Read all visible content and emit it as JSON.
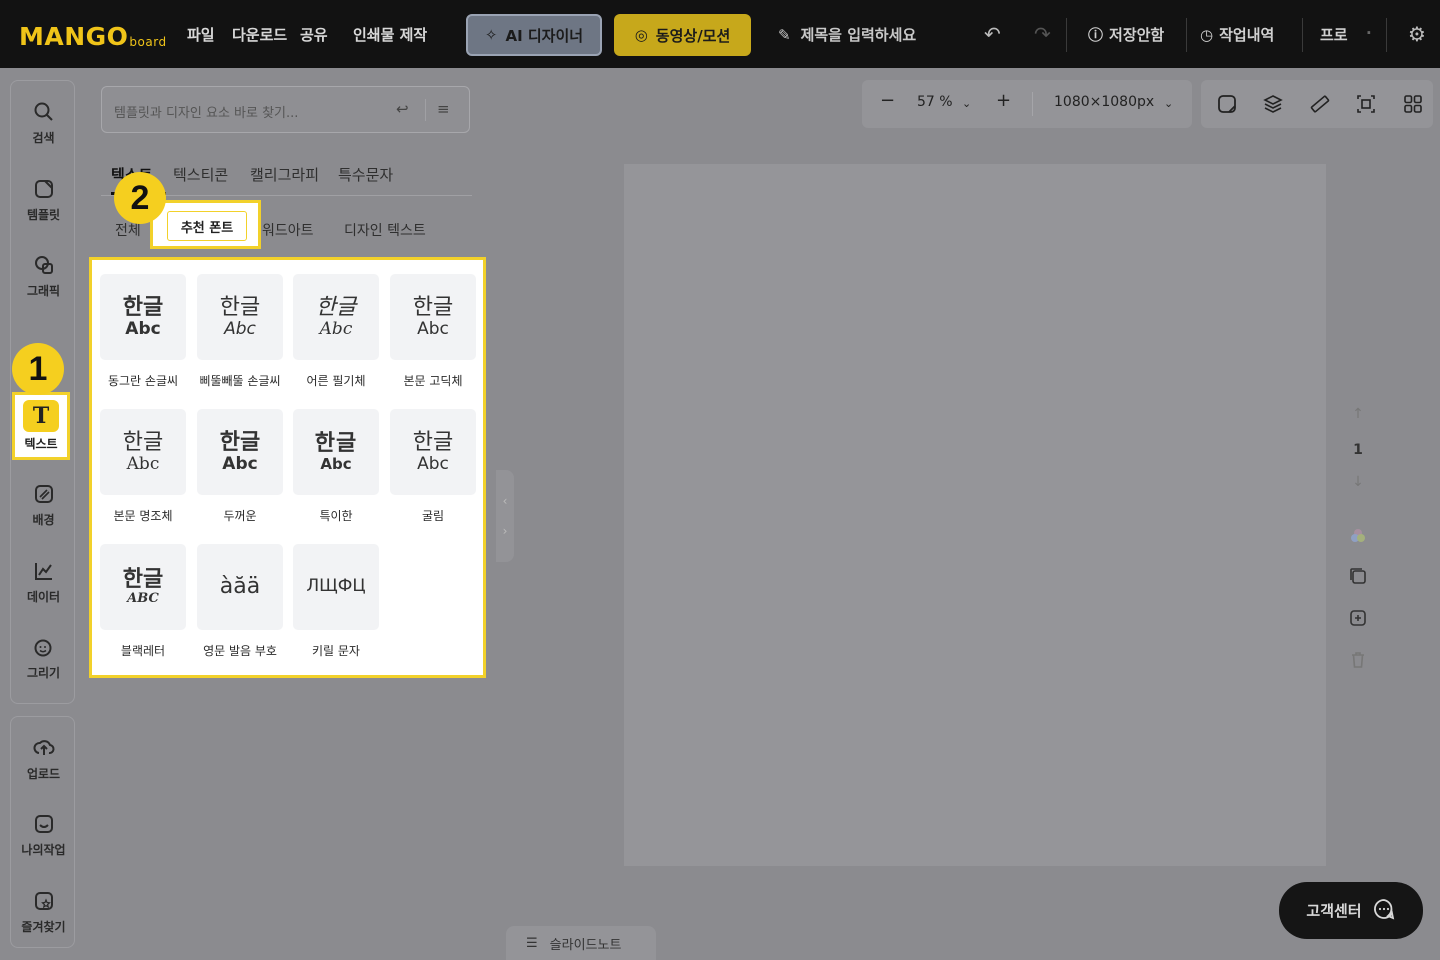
{
  "app": {
    "logo_main": "MANGO",
    "logo_sub": "board"
  },
  "topbar": {
    "menu": [
      "파일",
      "다운로드",
      "공유",
      "인쇄물 제작"
    ],
    "ai_button": "AI 디자이너",
    "video_button": "동영상/모션",
    "title_placeholder": "제목을 입력하세요",
    "save_status": "저장안함",
    "history": "작업내역",
    "pro": "프로"
  },
  "rail": {
    "items": [
      {
        "label": "검색",
        "icon": "search-icon"
      },
      {
        "label": "템플릿",
        "icon": "template-icon"
      },
      {
        "label": "그래픽",
        "icon": "graphic-icon"
      },
      {
        "label": "텍스트",
        "icon": "text-icon"
      },
      {
        "label": "배경",
        "icon": "background-icon"
      },
      {
        "label": "데이터",
        "icon": "chart-icon"
      },
      {
        "label": "그리기",
        "icon": "draw-icon"
      }
    ],
    "bottom_items": [
      {
        "label": "업로드",
        "icon": "upload-icon"
      },
      {
        "label": "나의작업",
        "icon": "mywork-icon"
      },
      {
        "label": "즐겨찾기",
        "icon": "favorite-icon"
      }
    ],
    "active_glyph": "T"
  },
  "badges": {
    "one": "1",
    "two": "2"
  },
  "panel": {
    "search_placeholder": "템플릿과 디자인 요소 바로 찾기...",
    "tabs": [
      "텍스트",
      "텍스티콘",
      "캘리그라피",
      "특수문자"
    ],
    "subtabs": [
      "전체",
      "추천 폰트",
      "워드아트",
      "디자인 텍스트"
    ],
    "fonts": [
      {
        "k": "한글",
        "a": "Abc",
        "label": "동그란 손글씨"
      },
      {
        "k": "한글",
        "a": "Abc",
        "label": "삐뚤빼뚤 손글씨"
      },
      {
        "k": "한글",
        "a": "Abc",
        "label": "어른 필기체"
      },
      {
        "k": "한글",
        "a": "Abc",
        "label": "본문 고딕체"
      },
      {
        "k": "한글",
        "a": "Abc",
        "label": "본문 명조체"
      },
      {
        "k": "한글",
        "a": "Abc",
        "label": "두꺼운"
      },
      {
        "k": "한글",
        "a": "Abc",
        "label": "특이한"
      },
      {
        "k": "한글",
        "a": "Abc",
        "label": "굴림"
      },
      {
        "k": "한글",
        "a": "ABC",
        "label": "블랙레터"
      },
      {
        "k": "àăä",
        "a": "",
        "label": "영문 발음 부호"
      },
      {
        "k": "ЛЩФЦ",
        "a": "",
        "label": "키릴 문자"
      }
    ]
  },
  "canvas": {
    "zoom": "57 %",
    "size": "1080×1080px",
    "page_number": "1"
  },
  "help": "고객센터",
  "slide_note": "슬라이드노트"
}
